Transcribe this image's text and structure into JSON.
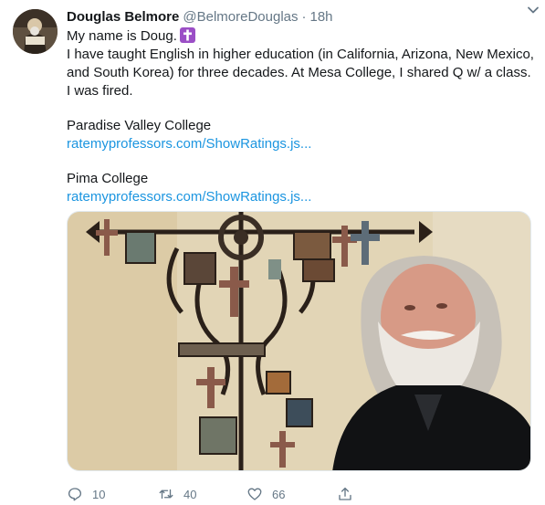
{
  "tweet": {
    "name": "Douglas Belmore",
    "handle": "@BelmoreDouglas",
    "separator": "·",
    "time": "18h",
    "lines": {
      "intro": "My name is Doug.",
      "body1": "I have taught English in higher education (in California, Arizona, New Mexico,",
      "body2": "and South Korea) for three decades. At Mesa College, I shared Q w/ a class.",
      "body3": "I was fired.",
      "college1": "Paradise Valley College",
      "link1": "ratemyprofessors.com/ShowRatings.js...",
      "college2": "Pima College",
      "link2": "ratemyprofessors.com/ShowRatings.js..."
    },
    "emoji_icon": "latin-cross-emoji",
    "menu_icon": "chevron-down-icon"
  },
  "actions": {
    "reply": {
      "icon": "reply-icon",
      "count": "10"
    },
    "retweet": {
      "icon": "retweet-icon",
      "count": "40"
    },
    "like": {
      "icon": "heart-icon",
      "count": "66"
    },
    "share": {
      "icon": "share-icon"
    }
  },
  "colors": {
    "link": "#1b95e0",
    "secondary_text": "#657786",
    "primary_text": "#14171a",
    "emoji_purple": "#9b4fc6"
  }
}
